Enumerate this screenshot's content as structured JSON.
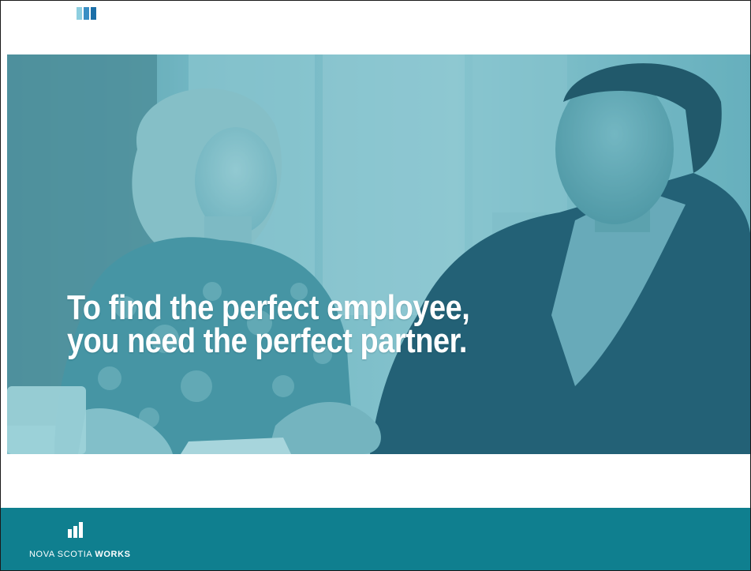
{
  "slide": {
    "headline_line1": "To find the perfect employee,",
    "headline_line2": "you need the perfect partner."
  },
  "footer": {
    "brand_light": "NOVA SCOTIA ",
    "brand_bold": "WORKS"
  },
  "colors": {
    "footer_bg": "#0f7f8f",
    "hero_tint": "#5aa9b8",
    "logo_light": "#8ecfe0",
    "logo_dark": "#1b6fa8",
    "headline": "#ffffff"
  },
  "icons": {
    "top_logo": "bars-logo-icon",
    "footer_logo": "bars-logo-icon"
  }
}
